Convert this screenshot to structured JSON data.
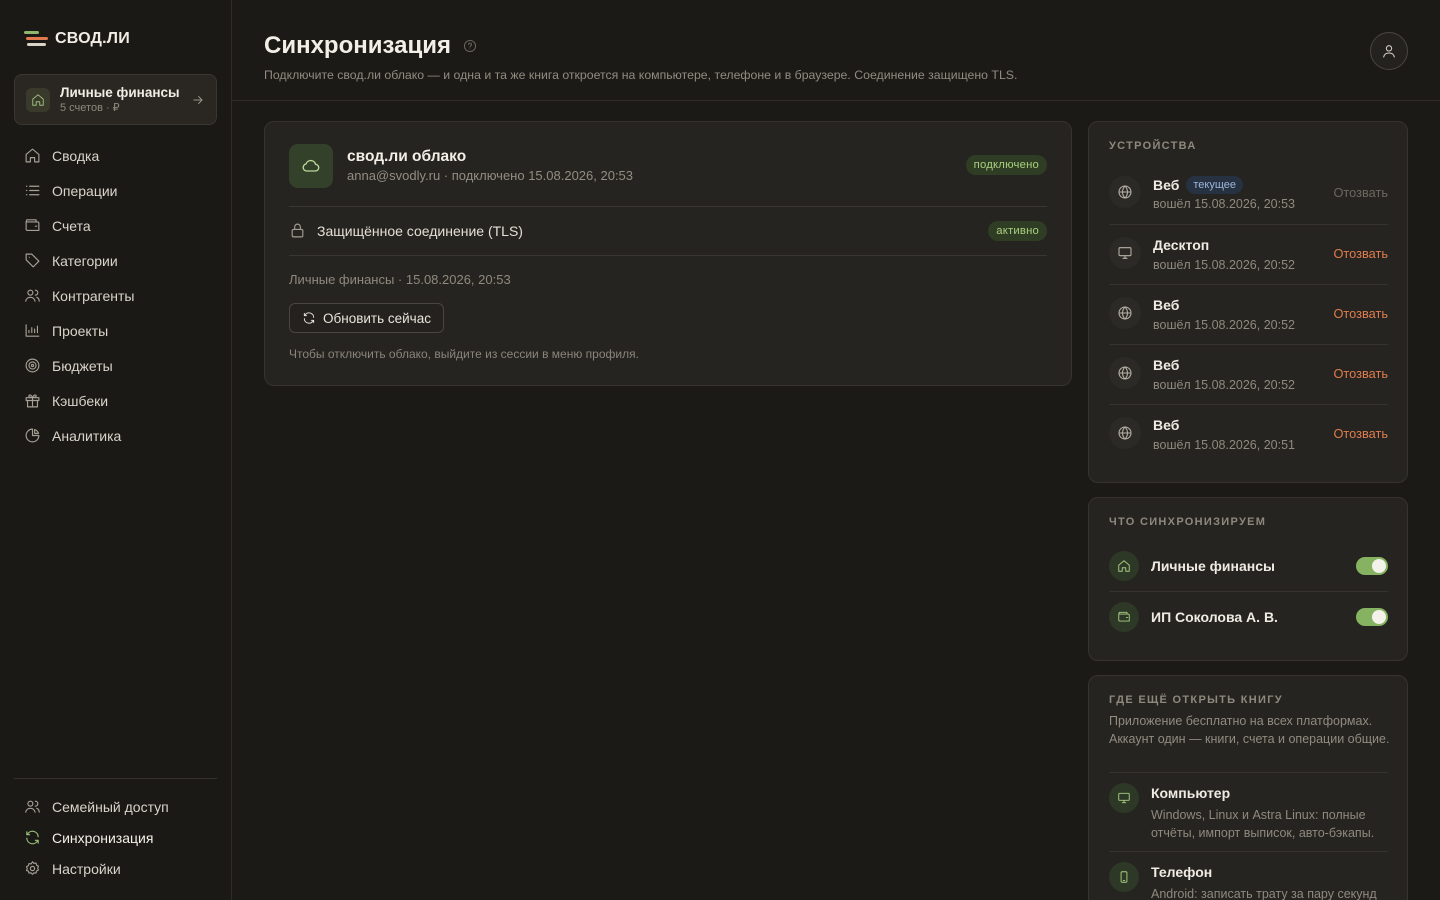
{
  "brand": {
    "name": "СВОД.ЛИ"
  },
  "book": {
    "title": "Личные финансы",
    "meta": "5 счетов · ₽"
  },
  "nav": {
    "items": [
      {
        "label": "Сводка",
        "icon": "home-icon"
      },
      {
        "label": "Операции",
        "icon": "list-icon"
      },
      {
        "label": "Счета",
        "icon": "wallet-icon"
      },
      {
        "label": "Категории",
        "icon": "tag-icon"
      },
      {
        "label": "Контрагенты",
        "icon": "users-icon"
      },
      {
        "label": "Проекты",
        "icon": "chart-bar-icon"
      },
      {
        "label": "Бюджеты",
        "icon": "target-icon"
      },
      {
        "label": "Кэшбеки",
        "icon": "gift-icon"
      },
      {
        "label": "Аналитика",
        "icon": "pie-chart-icon"
      }
    ],
    "bottom": [
      {
        "label": "Семейный доступ",
        "icon": "users-icon"
      },
      {
        "label": "Синхронизация",
        "icon": "sync-icon",
        "active": true
      },
      {
        "label": "Настройки",
        "icon": "gear-icon"
      }
    ]
  },
  "header": {
    "title": "Синхронизация",
    "subtitle": "Подключите свод.ли облако — и одна и та же книга откроется на компьютере, телефоне и в браузере. Соединение защищено TLS."
  },
  "cloud": {
    "title": "свод.ли облако",
    "subtitle": "anna@svodly.ru · подключено 15.08.2026, 20:53",
    "status": "подключено",
    "tls_label": "Защищённое соединение (TLS)",
    "tls_status": "активно",
    "last_sync": "Личные финансы · 15.08.2026, 20:53",
    "refresh_label": "Обновить сейчас",
    "hint": "Чтобы отключить облако, выйдите из сессии в меню профиля."
  },
  "devices": {
    "label": "Устройства",
    "current_badge": "текущее",
    "items": [
      {
        "name": "Веб",
        "when": "вошёл 15.08.2026, 20:53",
        "action": "Отозвать",
        "current": true,
        "icon": "globe-icon"
      },
      {
        "name": "Десктоп",
        "when": "вошёл 15.08.2026, 20:52",
        "action": "Отозвать",
        "icon": "monitor-icon"
      },
      {
        "name": "Веб",
        "when": "вошёл 15.08.2026, 20:52",
        "action": "Отозвать",
        "icon": "globe-icon"
      },
      {
        "name": "Веб",
        "when": "вошёл 15.08.2026, 20:52",
        "action": "Отозвать",
        "icon": "globe-icon"
      },
      {
        "name": "Веб",
        "when": "вошёл 15.08.2026, 20:51",
        "action": "Отозвать",
        "icon": "globe-icon"
      }
    ]
  },
  "sync_what": {
    "label": "Что синхронизируем",
    "items": [
      {
        "name": "Личные финансы",
        "enabled": true,
        "icon": "home-icon"
      },
      {
        "name": "ИП Соколова А. В.",
        "enabled": true,
        "icon": "wallet-icon"
      }
    ]
  },
  "where": {
    "label": "Где ещё открыть книгу",
    "description": "Приложение бесплатно на всех платформах. Аккаунт один — книги, счета и операции общие.",
    "platforms": [
      {
        "name": "Компьютер",
        "desc": "Windows, Linux и Astra Linux: полные отчёты, импорт выписок, авто-бэкапы.",
        "icon": "monitor-icon"
      },
      {
        "name": "Телефон",
        "desc": "Android: записать трату за пару секунд",
        "icon": "phone-icon"
      }
    ]
  },
  "colors": {
    "accent": "#86b361",
    "danger": "#e07c4e",
    "background": "#1c1a17",
    "card": "#262420"
  }
}
